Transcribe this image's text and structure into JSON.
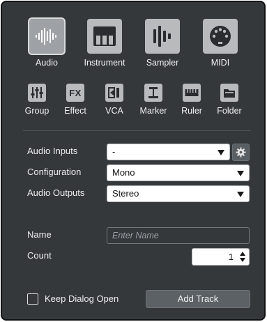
{
  "track_types": [
    {
      "label": "Audio",
      "icon": "audio-waveform-icon",
      "selected": true
    },
    {
      "label": "Instrument",
      "icon": "piano-keys-icon",
      "selected": false
    },
    {
      "label": "Sampler",
      "icon": "sampler-bars-icon",
      "selected": false
    },
    {
      "label": "MIDI",
      "icon": "midi-connector-icon",
      "selected": false
    }
  ],
  "small_types": [
    {
      "label": "Group",
      "icon": "group-faders-icon"
    },
    {
      "label": "Effect",
      "icon": "fx-icon",
      "glyph": "FX"
    },
    {
      "label": "VCA",
      "icon": "vca-icon"
    },
    {
      "label": "Marker",
      "icon": "marker-icon"
    },
    {
      "label": "Ruler",
      "icon": "ruler-icon"
    },
    {
      "label": "Folder",
      "icon": "folder-icon"
    }
  ],
  "form": {
    "audio_inputs_label": "Audio Inputs",
    "audio_inputs_value": "-",
    "configuration_label": "Configuration",
    "configuration_value": "Mono",
    "audio_outputs_label": "Audio Outputs",
    "audio_outputs_value": "Stereo",
    "name_label": "Name",
    "name_placeholder": "Enter Name",
    "count_label": "Count",
    "count_value": "1"
  },
  "footer": {
    "keep_open_label": "Keep Dialog Open",
    "keep_open_checked": false,
    "add_track_label": "Add Track"
  },
  "colors": {
    "panel_bg": "#35383b",
    "tile": "#b8babc",
    "tile_selected": "#9ea2a6",
    "icon": "#2a2c2f"
  }
}
